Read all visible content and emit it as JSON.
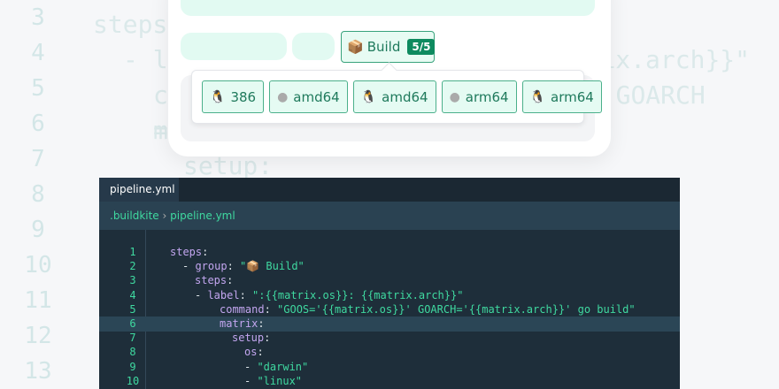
{
  "background": {
    "line_numbers": [
      "3",
      "4",
      "5",
      "6",
      "7",
      "8",
      "9",
      "10",
      "11",
      "12",
      "13"
    ],
    "code": [
      {
        "text": "steps:",
        "indent": 0
      },
      {
        "text": "- label: \":{{matrix.os}}: {{matrix.arch}}\"",
        "indent": 2
      },
      {
        "text": "command: \"GOOS='{{matrix.os}}' GOARCH='{{matrix.arch}}' go build\"",
        "indent": 4
      },
      {
        "text": "matrix:",
        "indent": 4
      },
      {
        "text": "setup:",
        "indent": 6
      }
    ]
  },
  "pipeline": {
    "group": {
      "icon": "📦",
      "label": "Build",
      "count": "5/5"
    },
    "jobs": [
      {
        "os": "linux",
        "icon": "🐧",
        "label": "386"
      },
      {
        "os": "darwin",
        "icon": "",
        "label": "amd64"
      },
      {
        "os": "linux",
        "icon": "🐧",
        "label": "amd64"
      },
      {
        "os": "darwin",
        "icon": "",
        "label": "arm64"
      },
      {
        "os": "linux",
        "icon": "🐧",
        "label": "arm64"
      }
    ]
  },
  "editor": {
    "tab": "pipeline.yml",
    "breadcrumb": {
      "folder": ".buildkite",
      "sep": " › ",
      "file": "pipeline.yml"
    },
    "highlighted_line": 6,
    "lines": [
      {
        "n": "1",
        "indent": 0,
        "key": "steps",
        "val": ""
      },
      {
        "n": "2",
        "indent": 1,
        "dash": true,
        "key": "group",
        "val": "\"📦 Build\""
      },
      {
        "n": "3",
        "indent": 2,
        "key": "steps",
        "val": ""
      },
      {
        "n": "4",
        "indent": 2,
        "dash": true,
        "key": "label",
        "val": "\":{{matrix.os}}: {{matrix.arch}}\""
      },
      {
        "n": "5",
        "indent": 4,
        "key": "command",
        "val": "\"GOOS='{{matrix.os}}' GOARCH='{{matrix.arch}}' go build\""
      },
      {
        "n": "6",
        "indent": 4,
        "key": "matrix",
        "val": ""
      },
      {
        "n": "7",
        "indent": 5,
        "key": "setup",
        "val": ""
      },
      {
        "n": "8",
        "indent": 6,
        "key": "os",
        "val": ""
      },
      {
        "n": "9",
        "indent": 6,
        "dash": true,
        "key": "",
        "val": "\"darwin\""
      },
      {
        "n": "10",
        "indent": 6,
        "dash": true,
        "key": "",
        "val": "\"linux\""
      }
    ]
  }
}
